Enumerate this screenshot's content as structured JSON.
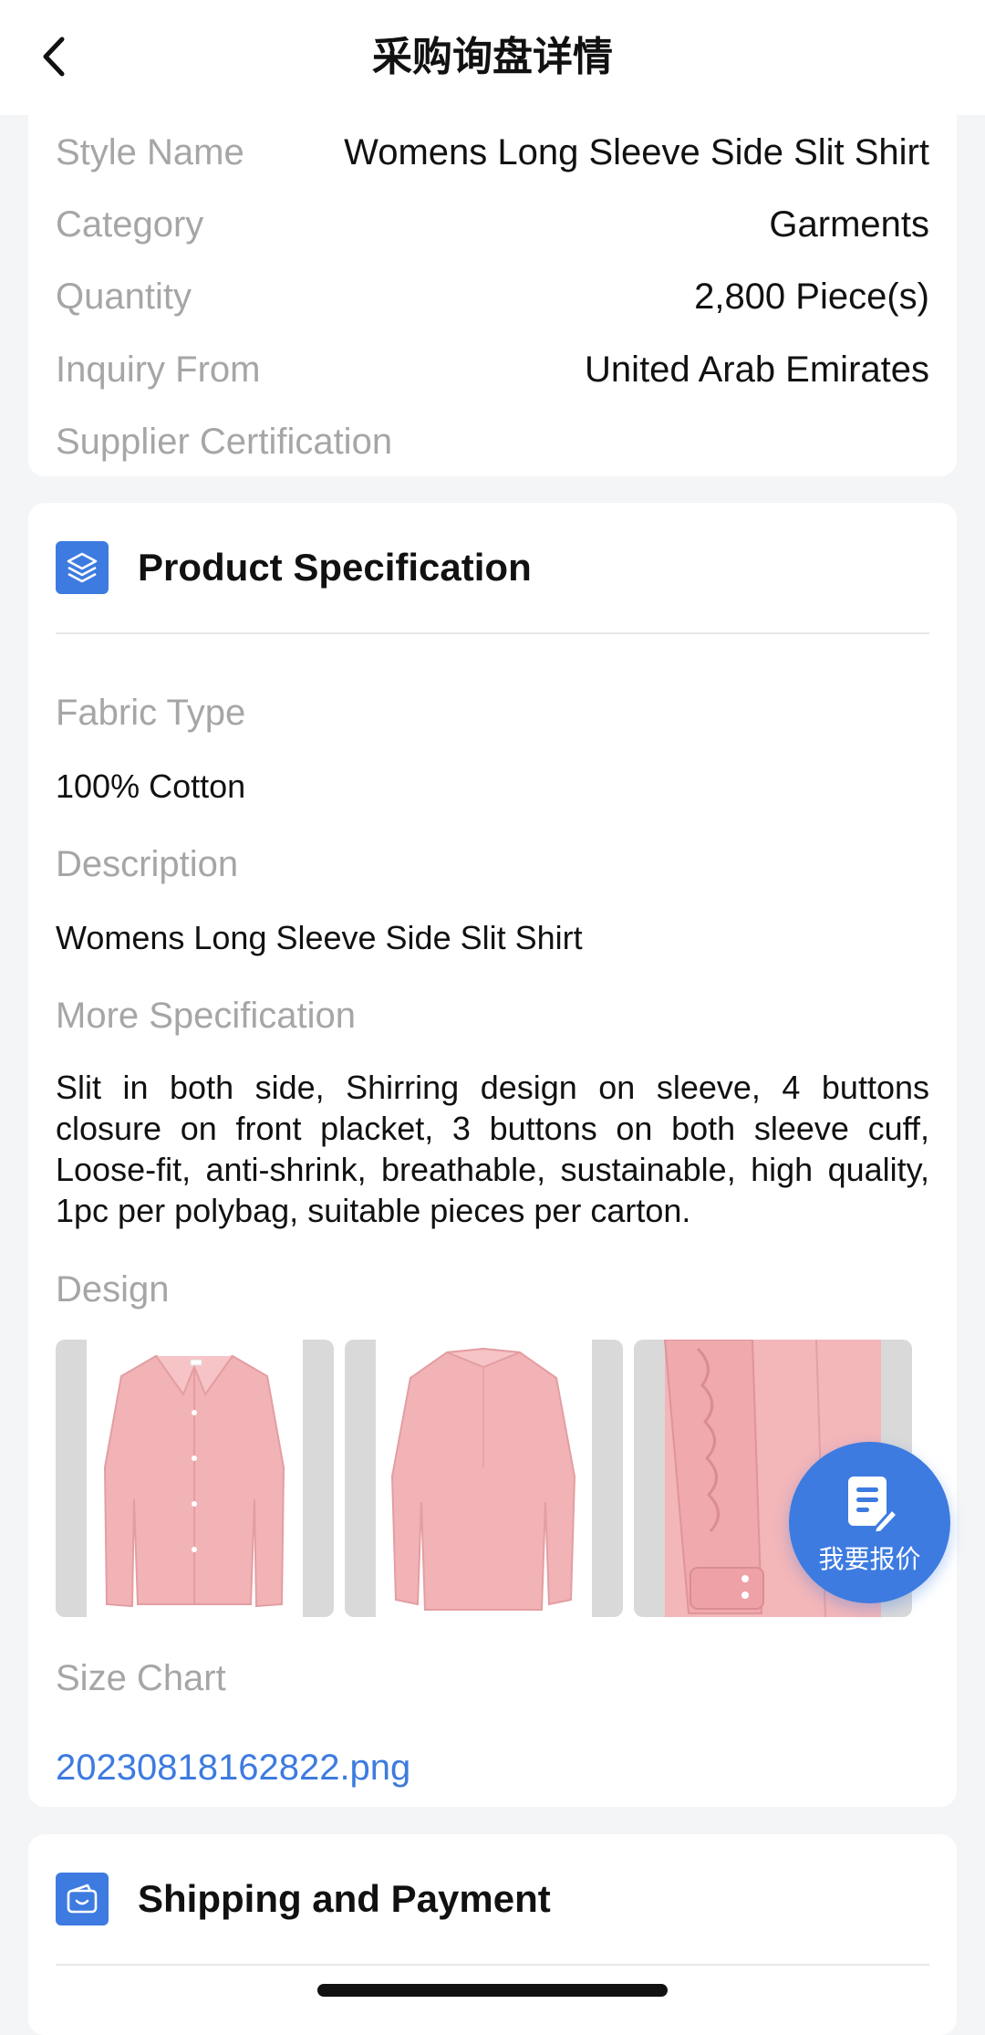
{
  "nav": {
    "title": "采购询盘详情",
    "back_icon": "chevron-left-icon"
  },
  "info": {
    "rows": [
      {
        "label": "Style Name",
        "value": "Womens Long Sleeve Side Slit Shirt"
      },
      {
        "label": "Category",
        "value": "Garments"
      },
      {
        "label": "Quantity",
        "value": "2,800 Piece(s)"
      },
      {
        "label": "Inquiry From",
        "value": "United Arab Emirates"
      },
      {
        "label": "Supplier Certification",
        "value": ""
      }
    ]
  },
  "spec": {
    "title": "Product Specification",
    "icon": "layers-icon",
    "fabric_label": "Fabric Type",
    "fabric_value": "100% Cotton",
    "description_label": "Description",
    "description_value": "Womens Long Sleeve Side Slit Shirt",
    "more_label": "More Specification",
    "more_value": "Slit in both side, Shirring design on sleeve, 4 buttons closure on front placket, 3 buttons on both sleeve cuff, Loose-fit, anti-shrink, breathable, sustainable, high quality, 1pc per polybag, suitable pieces per carton.",
    "design_label": "Design",
    "design_images": [
      "shirt-front-image",
      "shirt-back-image",
      "shirt-sleeve-detail-image"
    ],
    "size_chart_label": "Size Chart",
    "size_chart_file": "20230818162822.png"
  },
  "shipping": {
    "title": "Shipping and Payment",
    "icon": "wallet-icon"
  },
  "fab": {
    "label": "我要报价",
    "icon": "edit-document-icon"
  },
  "colors": {
    "accent": "#3d7be0",
    "label_gray": "#a6a6a6",
    "shirt_pink": "#f2b3b6"
  }
}
